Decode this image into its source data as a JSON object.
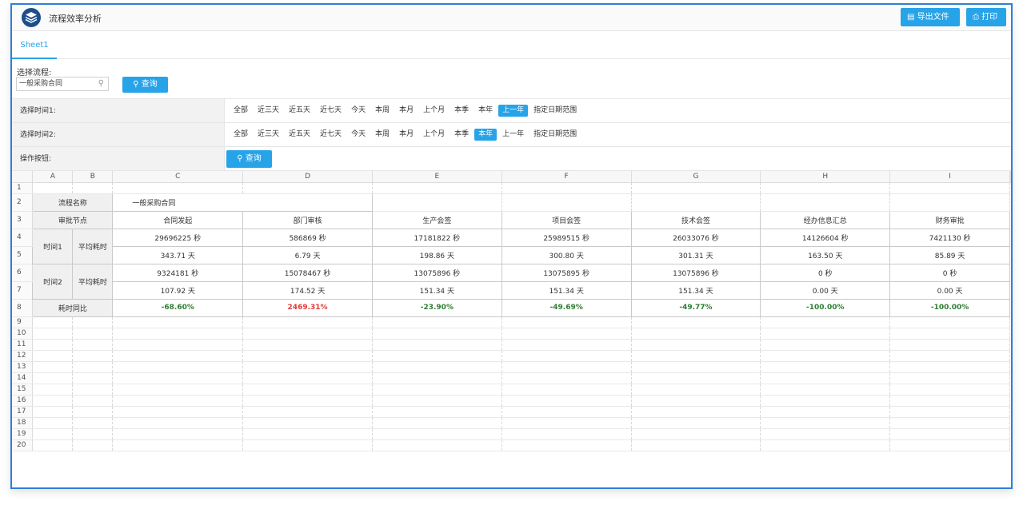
{
  "app": {
    "title": "流程效率分析"
  },
  "toolbar": {
    "export_label": "导出文件",
    "print_label": "打印"
  },
  "tabs": [
    {
      "label": "Sheet1"
    }
  ],
  "selector": {
    "label": "选择流程:",
    "value": "一般采购合同",
    "query_label": "查询"
  },
  "filters": {
    "time1": {
      "label": "选择时间1:",
      "options": [
        "全部",
        "近三天",
        "近五天",
        "近七天",
        "今天",
        "本周",
        "本月",
        "上个月",
        "本季",
        "本年",
        "上一年",
        "指定日期范围"
      ],
      "active": "上一年"
    },
    "time2": {
      "label": "选择时间2:",
      "options": [
        "全部",
        "近三天",
        "近五天",
        "近七天",
        "今天",
        "本周",
        "本月",
        "上个月",
        "本季",
        "本年",
        "上一年",
        "指定日期范围"
      ],
      "active": "本年"
    },
    "ops": {
      "label": "操作按钮:",
      "query_label": "查询"
    }
  },
  "sheet": {
    "columns": [
      "A",
      "B",
      "C",
      "D",
      "E",
      "F",
      "G",
      "H",
      "I"
    ],
    "row_numbers": [
      "1",
      "2",
      "3",
      "4",
      "5",
      "6",
      "7",
      "8",
      "9",
      "10",
      "11",
      "12",
      "13",
      "14",
      "15",
      "16",
      "17",
      "18",
      "19",
      "20"
    ],
    "flow_name_label": "流程名称",
    "flow_name_value": "一般采购合同",
    "node_label": "审批节点",
    "nodes": [
      "合同发起",
      "部门审核",
      "生产会签",
      "项目会签",
      "技术会签",
      "经办信息汇总",
      "财务审批"
    ],
    "time1_label": "时间1",
    "time2_label": "时间2",
    "avg_label": "平均耗时",
    "time1_seconds": [
      "29696225 秒",
      "586869 秒",
      "17181822 秒",
      "25989515 秒",
      "26033076 秒",
      "14126604 秒",
      "7421130 秒"
    ],
    "time1_days": [
      "343.71 天",
      "6.79 天",
      "198.86 天",
      "300.80 天",
      "301.31 天",
      "163.50 天",
      "85.89 天"
    ],
    "time2_seconds": [
      "9324181 秒",
      "15078467 秒",
      "13075896 秒",
      "13075895 秒",
      "13075896 秒",
      "0 秒",
      "0 秒"
    ],
    "time2_days": [
      "107.92 天",
      "174.52 天",
      "151.34 天",
      "151.34 天",
      "151.34 天",
      "0.00 天",
      "0.00 天"
    ],
    "ratio_label": "耗时同比",
    "ratios": [
      "-68.60%",
      "2469.31%",
      "-23.90%",
      "-49.69%",
      "-49.77%",
      "-100.00%",
      "-100.00%"
    ]
  },
  "colors": {
    "accent": "#27a3e8",
    "frame": "#2e7fd6",
    "negative": "#2e7d32",
    "positive": "#e53935"
  }
}
